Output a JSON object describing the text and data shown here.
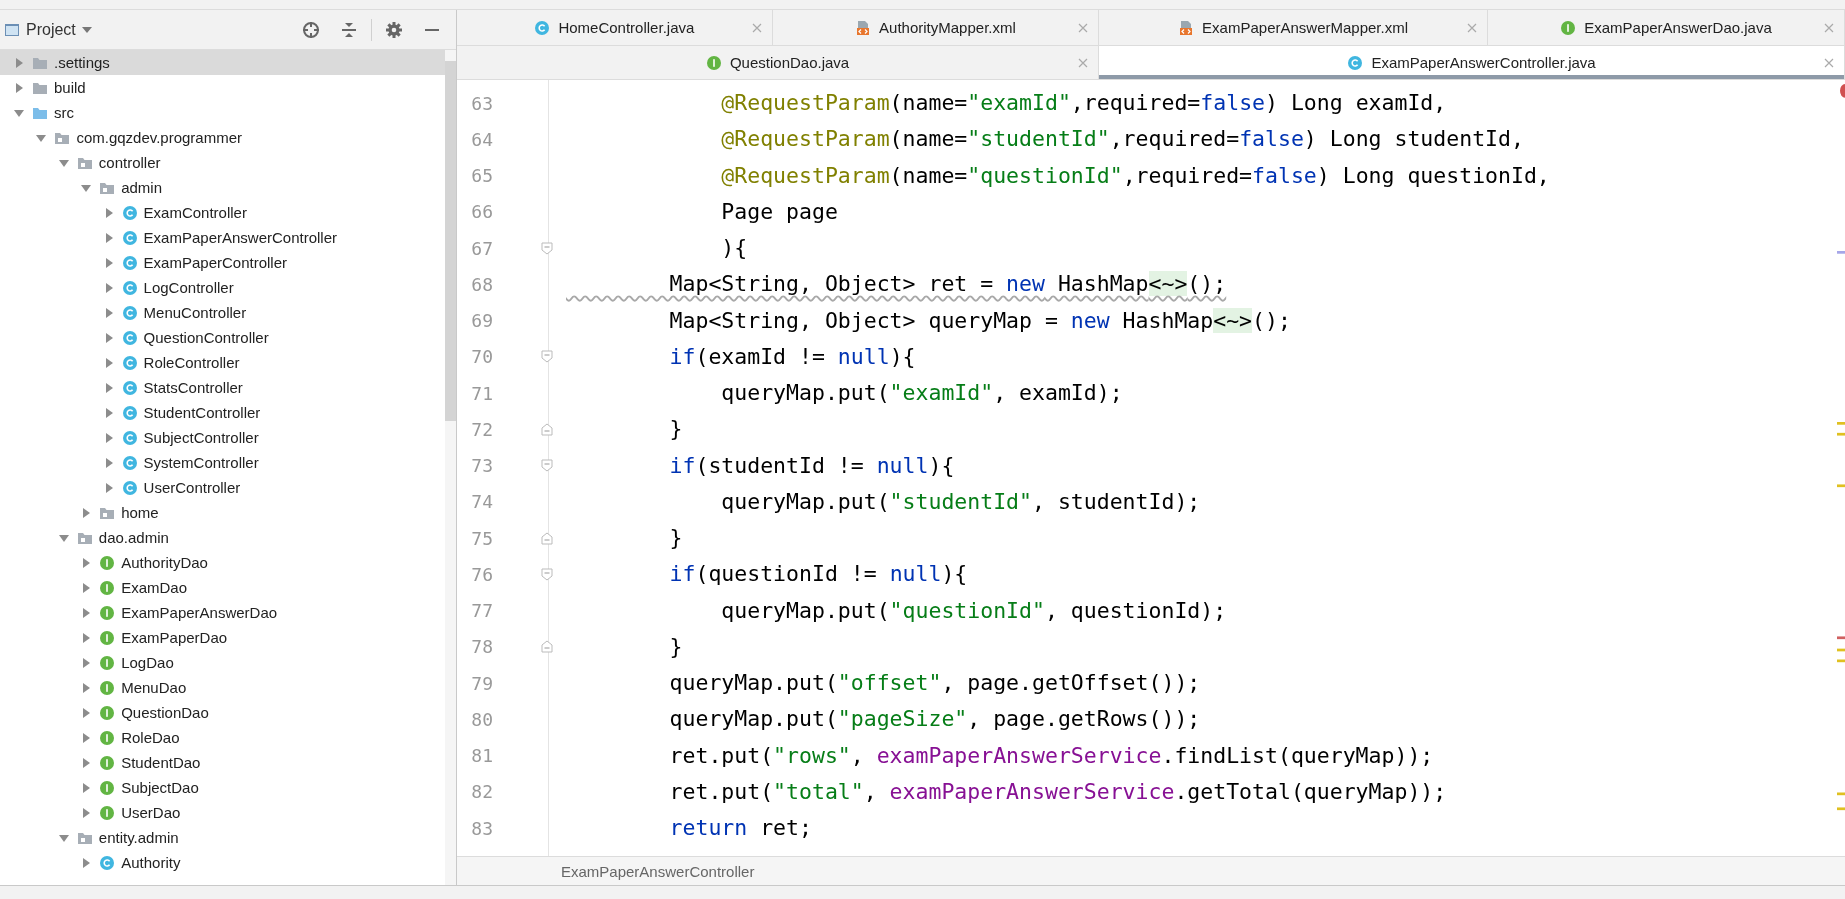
{
  "project_panel": {
    "title": "Project",
    "tree": [
      {
        "label": ".settings",
        "kind": "folder",
        "expanded": false,
        "selected": true
      },
      {
        "label": "build",
        "kind": "folder",
        "expanded": false,
        "selected": false
      },
      {
        "label": "src",
        "kind": "source_folder",
        "expanded": true,
        "selected": false,
        "children": [
          {
            "label": "com.gqzdev.programmer",
            "kind": "package",
            "expanded": true,
            "selected": false,
            "children": [
              {
                "label": "controller",
                "kind": "package",
                "expanded": true,
                "selected": false,
                "children": [
                  {
                    "label": "admin",
                    "kind": "package",
                    "expanded": true,
                    "selected": false,
                    "children": [
                      {
                        "label": "ExamController",
                        "kind": "class",
                        "expanded": false,
                        "selected": false
                      },
                      {
                        "label": "ExamPaperAnswerController",
                        "kind": "class",
                        "expanded": false,
                        "selected": false
                      },
                      {
                        "label": "ExamPaperController",
                        "kind": "class",
                        "expanded": false,
                        "selected": false
                      },
                      {
                        "label": "LogController",
                        "kind": "class",
                        "expanded": false,
                        "selected": false
                      },
                      {
                        "label": "MenuController",
                        "kind": "class",
                        "expanded": false,
                        "selected": false
                      },
                      {
                        "label": "QuestionController",
                        "kind": "class",
                        "expanded": false,
                        "selected": false
                      },
                      {
                        "label": "RoleController",
                        "kind": "class",
                        "expanded": false,
                        "selected": false
                      },
                      {
                        "label": "StatsController",
                        "kind": "class",
                        "expanded": false,
                        "selected": false
                      },
                      {
                        "label": "StudentController",
                        "kind": "class",
                        "expanded": false,
                        "selected": false
                      },
                      {
                        "label": "SubjectController",
                        "kind": "class",
                        "expanded": false,
                        "selected": false
                      },
                      {
                        "label": "SystemController",
                        "kind": "class",
                        "expanded": false,
                        "selected": false
                      },
                      {
                        "label": "UserController",
                        "kind": "class",
                        "expanded": false,
                        "selected": false
                      }
                    ]
                  },
                  {
                    "label": "home",
                    "kind": "package",
                    "expanded": false,
                    "selected": false
                  }
                ]
              },
              {
                "label": "dao.admin",
                "kind": "package",
                "expanded": true,
                "selected": false,
                "children": [
                  {
                    "label": "AuthorityDao",
                    "kind": "interface",
                    "expanded": false,
                    "selected": false
                  },
                  {
                    "label": "ExamDao",
                    "kind": "interface",
                    "expanded": false,
                    "selected": false
                  },
                  {
                    "label": "ExamPaperAnswerDao",
                    "kind": "interface",
                    "expanded": false,
                    "selected": false
                  },
                  {
                    "label": "ExamPaperDao",
                    "kind": "interface",
                    "expanded": false,
                    "selected": false
                  },
                  {
                    "label": "LogDao",
                    "kind": "interface",
                    "expanded": false,
                    "selected": false
                  },
                  {
                    "label": "MenuDao",
                    "kind": "interface",
                    "expanded": false,
                    "selected": false
                  },
                  {
                    "label": "QuestionDao",
                    "kind": "interface",
                    "expanded": false,
                    "selected": false
                  },
                  {
                    "label": "RoleDao",
                    "kind": "interface",
                    "expanded": false,
                    "selected": false
                  },
                  {
                    "label": "StudentDao",
                    "kind": "interface",
                    "expanded": false,
                    "selected": false
                  },
                  {
                    "label": "SubjectDao",
                    "kind": "interface",
                    "expanded": false,
                    "selected": false
                  },
                  {
                    "label": "UserDao",
                    "kind": "interface",
                    "expanded": false,
                    "selected": false
                  }
                ]
              },
              {
                "label": "entity.admin",
                "kind": "package",
                "expanded": true,
                "selected": false,
                "children": [
                  {
                    "label": "Authority",
                    "kind": "class",
                    "expanded": false,
                    "selected": false
                  }
                ]
              }
            ]
          }
        ]
      }
    ]
  },
  "editor": {
    "tab_rows": [
      [
        {
          "label": "HomeController.java",
          "kind": "class",
          "selected": false
        },
        {
          "label": "AuthorityMapper.xml",
          "kind": "xml",
          "selected": false
        },
        {
          "label": "ExamPaperAnswerMapper.xml",
          "kind": "xml",
          "selected": false
        },
        {
          "label": "ExamPaperAnswerDao.java",
          "kind": "interface",
          "selected": false
        }
      ],
      [
        {
          "label": "QuestionDao.java",
          "kind": "interface",
          "selected": false
        },
        {
          "label": "ExamPaperAnswerController.java",
          "kind": "class",
          "selected": true
        }
      ]
    ],
    "lines": [
      {
        "number": "63",
        "kind": "plain",
        "warning": false,
        "tokens": [
          {
            "kind": "annotation",
            "text": "            @RequestParam"
          },
          {
            "kind": "plain",
            "text": "(name="
          },
          {
            "kind": "string",
            "text": "\"examId\""
          },
          {
            "kind": "plain",
            "text": ",required="
          },
          {
            "kind": "keyword",
            "text": "false"
          },
          {
            "kind": "plain",
            "text": ") Long examId,"
          }
        ]
      },
      {
        "number": "64",
        "kind": "plain",
        "warning": false,
        "tokens": [
          {
            "kind": "annotation",
            "text": "            @RequestParam"
          },
          {
            "kind": "plain",
            "text": "(name="
          },
          {
            "kind": "string",
            "text": "\"studentId\""
          },
          {
            "kind": "plain",
            "text": ",required="
          },
          {
            "kind": "keyword",
            "text": "false"
          },
          {
            "kind": "plain",
            "text": ") Long studentId,"
          }
        ]
      },
      {
        "number": "65",
        "kind": "plain",
        "warning": false,
        "tokens": [
          {
            "kind": "annotation",
            "text": "            @RequestParam"
          },
          {
            "kind": "plain",
            "text": "(name="
          },
          {
            "kind": "string",
            "text": "\"questionId\""
          },
          {
            "kind": "plain",
            "text": ",required="
          },
          {
            "kind": "keyword",
            "text": "false"
          },
          {
            "kind": "plain",
            "text": ") Long questionId,"
          }
        ]
      },
      {
        "number": "66",
        "kind": "plain",
        "warning": false,
        "tokens": [
          {
            "kind": "plain",
            "text": "            Page page"
          }
        ]
      },
      {
        "number": "67",
        "kind": "block_start",
        "warning": false,
        "tokens": [
          {
            "kind": "plain",
            "text": "            ){"
          }
        ]
      },
      {
        "number": "68",
        "kind": "plain",
        "warning": true,
        "tokens": [
          {
            "kind": "plain",
            "text": "        Map<String, Object> ret = "
          },
          {
            "kind": "keyword",
            "text": "new"
          },
          {
            "kind": "plain",
            "text": " HashMap"
          },
          {
            "kind": "folded",
            "text": "<~>"
          },
          {
            "kind": "plain",
            "text": "();"
          }
        ]
      },
      {
        "number": "69",
        "kind": "plain",
        "warning": false,
        "tokens": [
          {
            "kind": "plain",
            "text": "        Map<String, Object> queryMap = "
          },
          {
            "kind": "keyword",
            "text": "new"
          },
          {
            "kind": "plain",
            "text": " HashMap"
          },
          {
            "kind": "folded",
            "text": "<~>"
          },
          {
            "kind": "plain",
            "text": "();"
          }
        ]
      },
      {
        "number": "70",
        "kind": "block_start",
        "warning": false,
        "tokens": [
          {
            "kind": "keyword",
            "text": "        if"
          },
          {
            "kind": "plain",
            "text": "(examId != "
          },
          {
            "kind": "keyword",
            "text": "null"
          },
          {
            "kind": "plain",
            "text": "){"
          }
        ]
      },
      {
        "number": "71",
        "kind": "plain",
        "warning": false,
        "tokens": [
          {
            "kind": "plain",
            "text": "            queryMap.put("
          },
          {
            "kind": "string",
            "text": "\"examId\""
          },
          {
            "kind": "plain",
            "text": ", examId);"
          }
        ]
      },
      {
        "number": "72",
        "kind": "block_end",
        "warning": false,
        "tokens": [
          {
            "kind": "plain",
            "text": "        }"
          }
        ]
      },
      {
        "number": "73",
        "kind": "block_start",
        "warning": false,
        "tokens": [
          {
            "kind": "keyword",
            "text": "        if"
          },
          {
            "kind": "plain",
            "text": "(studentId != "
          },
          {
            "kind": "keyword",
            "text": "null"
          },
          {
            "kind": "plain",
            "text": "){"
          }
        ]
      },
      {
        "number": "74",
        "kind": "plain",
        "warning": false,
        "tokens": [
          {
            "kind": "plain",
            "text": "            queryMap.put("
          },
          {
            "kind": "string",
            "text": "\"studentId\""
          },
          {
            "kind": "plain",
            "text": ", studentId);"
          }
        ]
      },
      {
        "number": "75",
        "kind": "block_end",
        "warning": false,
        "tokens": [
          {
            "kind": "plain",
            "text": "        }"
          }
        ]
      },
      {
        "number": "76",
        "kind": "block_start",
        "warning": false,
        "tokens": [
          {
            "kind": "keyword",
            "text": "        if"
          },
          {
            "kind": "plain",
            "text": "(questionId != "
          },
          {
            "kind": "keyword",
            "text": "null"
          },
          {
            "kind": "plain",
            "text": "){"
          }
        ]
      },
      {
        "number": "77",
        "kind": "plain",
        "warning": false,
        "tokens": [
          {
            "kind": "plain",
            "text": "            queryMap.put("
          },
          {
            "kind": "string",
            "text": "\"questionId\""
          },
          {
            "kind": "plain",
            "text": ", questionId);"
          }
        ]
      },
      {
        "number": "78",
        "kind": "block_end",
        "warning": false,
        "tokens": [
          {
            "kind": "plain",
            "text": "        }"
          }
        ]
      },
      {
        "number": "79",
        "kind": "plain",
        "warning": false,
        "tokens": [
          {
            "kind": "plain",
            "text": "        queryMap.put("
          },
          {
            "kind": "string",
            "text": "\"offset\""
          },
          {
            "kind": "plain",
            "text": ", page.getOffset());"
          }
        ]
      },
      {
        "number": "80",
        "kind": "plain",
        "warning": false,
        "tokens": [
          {
            "kind": "plain",
            "text": "        queryMap.put("
          },
          {
            "kind": "string",
            "text": "\"pageSize\""
          },
          {
            "kind": "plain",
            "text": ", page.getRows());"
          }
        ]
      },
      {
        "number": "81",
        "kind": "plain",
        "warning": false,
        "tokens": [
          {
            "kind": "plain",
            "text": "        ret.put("
          },
          {
            "kind": "string",
            "text": "\"rows\""
          },
          {
            "kind": "plain",
            "text": ", "
          },
          {
            "kind": "field",
            "text": "examPaperAnswerService"
          },
          {
            "kind": "plain",
            "text": ".findList(queryMap));"
          }
        ]
      },
      {
        "number": "82",
        "kind": "plain",
        "warning": false,
        "tokens": [
          {
            "kind": "plain",
            "text": "        ret.put("
          },
          {
            "kind": "string",
            "text": "\"total\""
          },
          {
            "kind": "plain",
            "text": ", "
          },
          {
            "kind": "field",
            "text": "examPaperAnswerService"
          },
          {
            "kind": "plain",
            "text": ".getTotal(queryMap));"
          }
        ]
      },
      {
        "number": "83",
        "kind": "plain",
        "warning": false,
        "tokens": [
          {
            "kind": "keyword",
            "text": "        return"
          },
          {
            "kind": "plain",
            "text": " ret;"
          }
        ]
      }
    ],
    "breadcrumb": "ExamPaperAnswerController"
  }
}
